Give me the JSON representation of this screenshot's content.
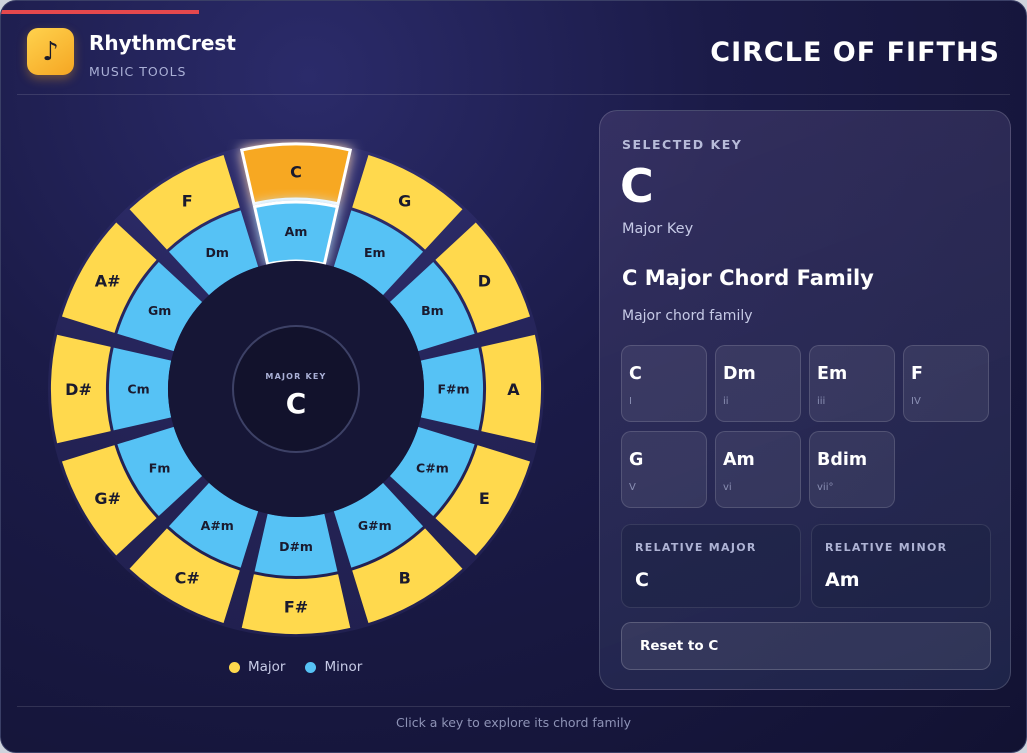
{
  "header": {
    "brand": "RhythmCrest",
    "subbrand": "MUSIC TOOLS",
    "logo_icon": "music-note-icon",
    "page_title": "CIRCLE OF FIFTHS"
  },
  "colors": {
    "major": "#ffd94d",
    "minor": "#56c2f5",
    "selected": "#f7a823",
    "progress": "#e5484d"
  },
  "wheel": {
    "major_keys": [
      "C",
      "G",
      "D",
      "A",
      "E",
      "B",
      "F#",
      "C#",
      "G#",
      "D#",
      "A#",
      "F"
    ],
    "minor_keys": [
      "Am",
      "Em",
      "Bm",
      "F#m",
      "C#m",
      "G#m",
      "D#m",
      "A#m",
      "Fm",
      "Cm",
      "Gm",
      "Dm"
    ],
    "selected_index": 0,
    "center_label": "MAJOR KEY",
    "center_key": "C"
  },
  "legend": {
    "major": "Major",
    "minor": "Minor"
  },
  "panel": {
    "selected_label": "SELECTED KEY",
    "selected_key": "C",
    "selected_type": "Major Key",
    "family_title": "C Major Chord Family",
    "family_subtitle": "Major chord family",
    "chords": [
      {
        "name": "C",
        "roman": "I"
      },
      {
        "name": "Dm",
        "roman": "ii"
      },
      {
        "name": "Em",
        "roman": "iii"
      },
      {
        "name": "F",
        "roman": "IV"
      },
      {
        "name": "G",
        "roman": "V"
      },
      {
        "name": "Am",
        "roman": "vi"
      },
      {
        "name": "Bdim",
        "roman": "vii°"
      }
    ],
    "relative_major_label": "RELATIVE MAJOR",
    "relative_major": "C",
    "relative_minor_label": "RELATIVE MINOR",
    "relative_minor": "Am",
    "reset_label": "Reset to C"
  },
  "footer": {
    "hint": "Click a key to explore its chord family"
  }
}
